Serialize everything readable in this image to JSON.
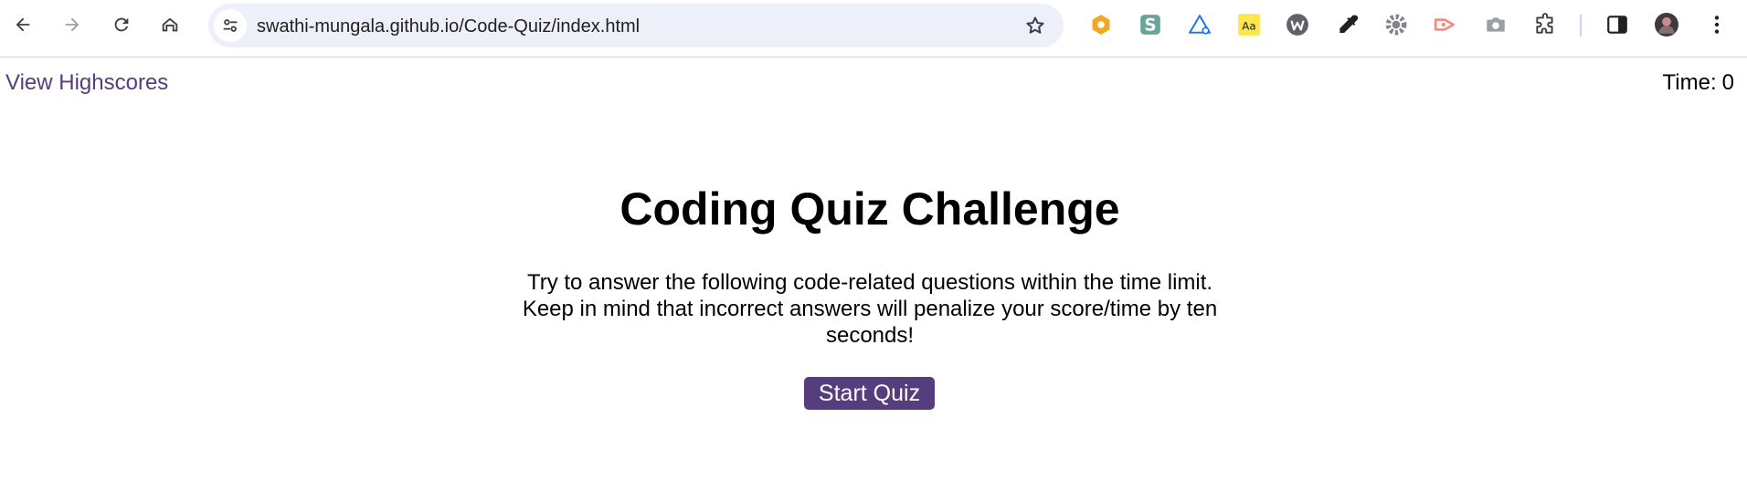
{
  "browser": {
    "url": "swathi-mungala.github.io/Code-Quiz/index.html",
    "icons": {
      "back": "back-arrow-icon",
      "forward": "forward-arrow-icon",
      "reload": "reload-icon",
      "home": "home-icon",
      "site_info": "tune-icon",
      "bookmark": "star-icon"
    },
    "extension_icons": [
      "hexagon-extension-icon",
      "s-extension-icon",
      "triangle-extension-icon",
      "aa-dictionary-icon",
      "w-extension-icon",
      "eyedropper-icon",
      "gear-extension-icon",
      "arrow-extension-icon",
      "camera-icon",
      "puzzle-extensions-icon",
      "side-panel-icon",
      "profile-avatar",
      "kebab-menu-icon"
    ]
  },
  "page": {
    "highscores_link": "View Highscores",
    "timer_label": "Time:",
    "timer_value": "0",
    "title": "Coding Quiz Challenge",
    "intro": "Try to answer the following code-related questions within the time limit. Keep in mind that incorrect answers will penalize your score/time by ten seconds!",
    "start_button": "Start Quiz"
  },
  "colors": {
    "accent": "#563d7c",
    "omnibox": "#edf0f8"
  }
}
